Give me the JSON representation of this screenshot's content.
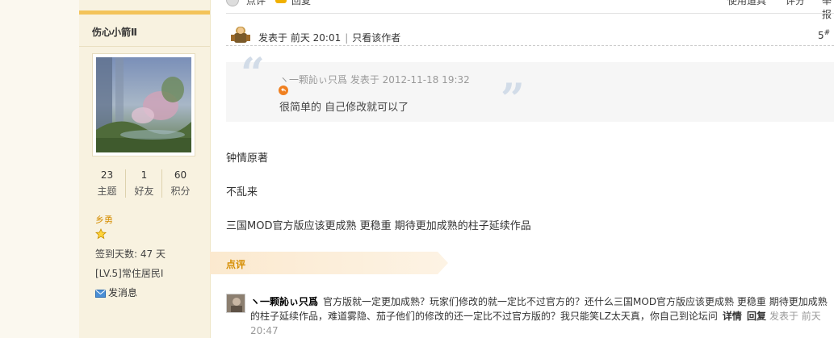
{
  "top_actions": {
    "rate_label": "点评",
    "reply_label": "回复",
    "tool_label": "使用道具",
    "score_label": "评分",
    "more_label": "举报"
  },
  "user": {
    "name": "伤心小箭Ⅱ",
    "stats": [
      {
        "value": "23",
        "label": "主题"
      },
      {
        "value": "1",
        "label": "好友"
      },
      {
        "value": "60",
        "label": "积分"
      }
    ],
    "rank": "乡勇",
    "sign_days": "签到天数: 47 天",
    "level": "[LV.5]常住居民I",
    "send_message": "发消息"
  },
  "post": {
    "posted_at": "发表于 前天 20:01",
    "only_author": "只看该作者",
    "floor": "5",
    "floor_sup": "#",
    "quote": {
      "author_line": "ヽ一颗訫ぃ只爲 发表于 2012-11-18 19:32",
      "text": "很简单的  自己修改就可以了"
    },
    "body": [
      "钟情原著",
      "不乱来",
      "三国MOD官方版应该更成熟 更稳重  期待更加成熟的柱子延续作品"
    ]
  },
  "comments": {
    "section_label": "点评",
    "items": [
      {
        "author": "ヽ一颗訫ぃ只爲",
        "text": "官方版就一定更加成熟？玩家们修改的就一定比不过官方的？还什么三国MOD官方版应该更成熟 更稳重 期待更加成熟的柱子延续作品，难道雾隐、茄子他们的修改的还一定比不过官方版的？我只能笑LZ太天真，你自己到论坛问",
        "detail_label": "详情",
        "reply_label": "回复",
        "date": "发表于 前天 20:47"
      }
    ]
  },
  "colors": {
    "accent_orange": "#d58d00",
    "sidebar_bg": "#f8f2e0",
    "quote_mark": "#d2dce8"
  }
}
